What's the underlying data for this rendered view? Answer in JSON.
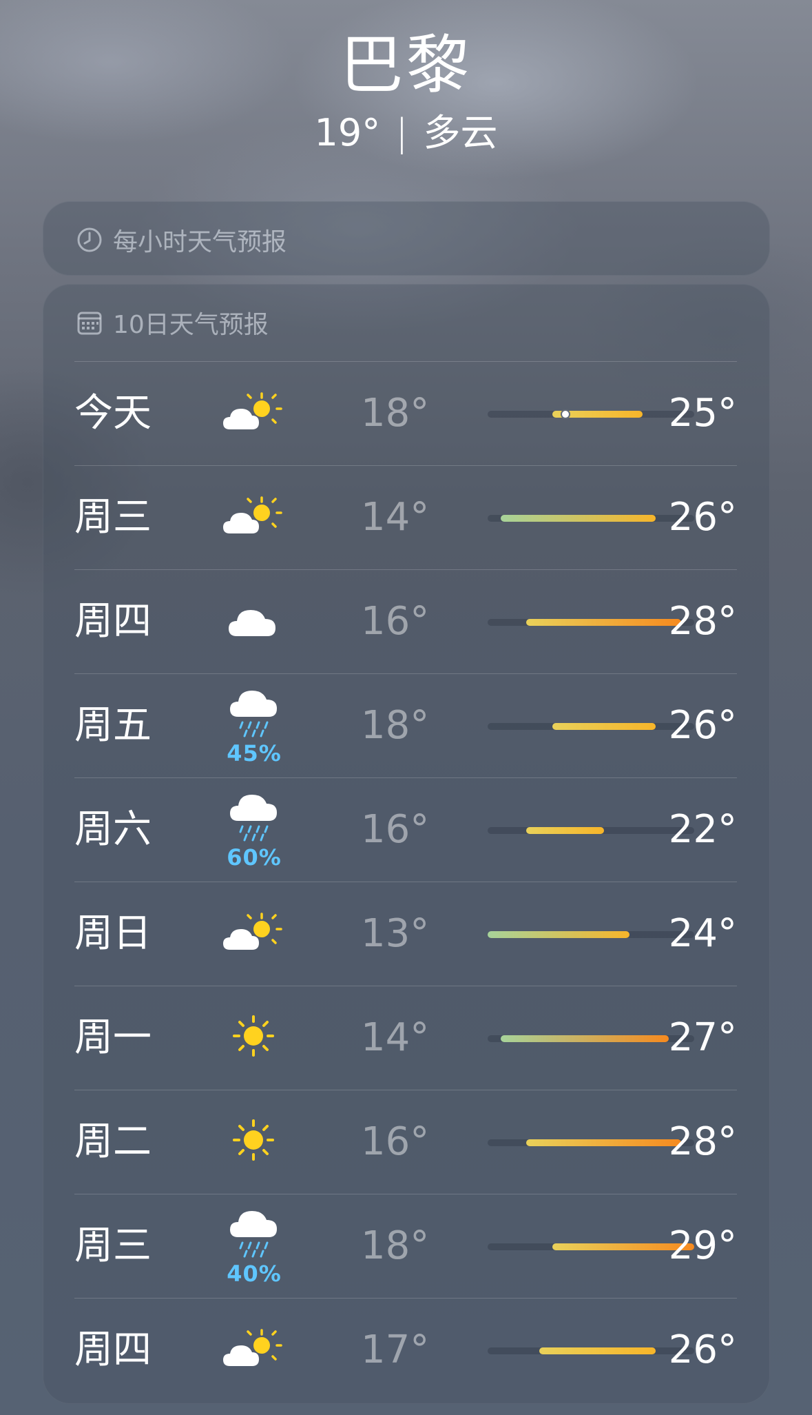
{
  "header": {
    "city": "巴黎",
    "current_temp": "19°",
    "separator": "|",
    "condition": "多云"
  },
  "hourly": {
    "icon": "clock-icon",
    "title": "每小时天气预报"
  },
  "daily": {
    "icon": "calendar-icon",
    "title": "10日天气预报",
    "range": {
      "min": 13,
      "max": 29
    },
    "current_temp_value": 19,
    "colors": {
      "cool": "#a7d39a",
      "mild": "#e9d15a",
      "warm": "#f7b52a",
      "hot": "#f68a1f",
      "precip": "#5fc6ff"
    },
    "days": [
      {
        "day": "今天",
        "icon": "partly-cloudy-sun-icon",
        "precip": null,
        "low": "18°",
        "high": "25°",
        "low_value": 18,
        "high_value": 25,
        "current_marker": true
      },
      {
        "day": "周三",
        "icon": "partly-cloudy-sun-icon",
        "precip": null,
        "low": "14°",
        "high": "26°",
        "low_value": 14,
        "high_value": 26
      },
      {
        "day": "周四",
        "icon": "cloud-icon",
        "precip": null,
        "low": "16°",
        "high": "28°",
        "low_value": 16,
        "high_value": 28
      },
      {
        "day": "周五",
        "icon": "rain-cloud-icon",
        "precip": "45%",
        "low": "18°",
        "high": "26°",
        "low_value": 18,
        "high_value": 26
      },
      {
        "day": "周六",
        "icon": "rain-cloud-icon",
        "precip": "60%",
        "low": "16°",
        "high": "22°",
        "low_value": 16,
        "high_value": 22
      },
      {
        "day": "周日",
        "icon": "partly-cloudy-sun-icon",
        "precip": null,
        "low": "13°",
        "high": "24°",
        "low_value": 13,
        "high_value": 24
      },
      {
        "day": "周一",
        "icon": "sun-icon",
        "precip": null,
        "low": "14°",
        "high": "27°",
        "low_value": 14,
        "high_value": 27
      },
      {
        "day": "周二",
        "icon": "sun-icon",
        "precip": null,
        "low": "16°",
        "high": "28°",
        "low_value": 16,
        "high_value": 28
      },
      {
        "day": "周三",
        "icon": "rain-cloud-icon",
        "precip": "40%",
        "low": "18°",
        "high": "29°",
        "low_value": 18,
        "high_value": 29
      },
      {
        "day": "周四",
        "icon": "partly-cloudy-sun-icon",
        "precip": null,
        "low": "17°",
        "high": "26°",
        "low_value": 17,
        "high_value": 26
      }
    ]
  }
}
